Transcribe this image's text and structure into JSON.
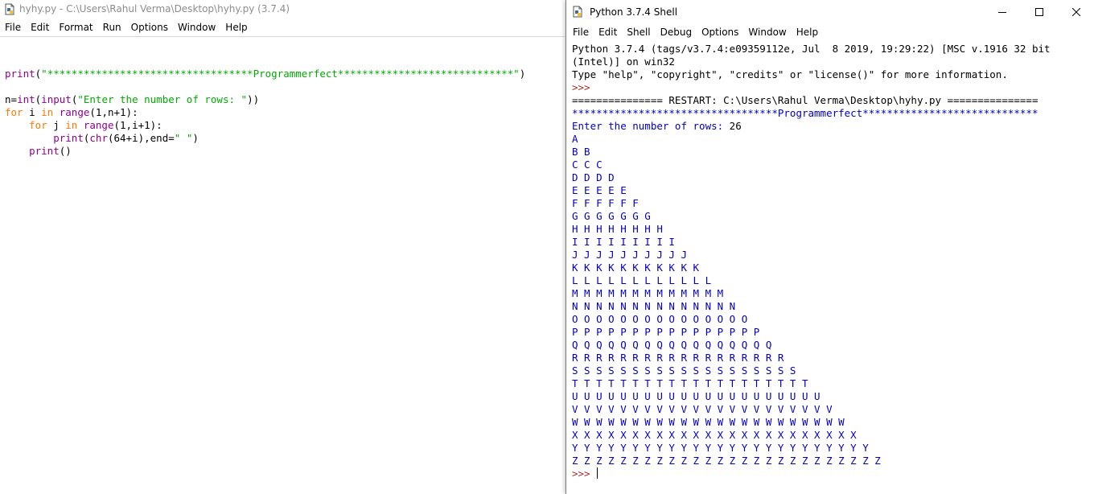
{
  "editor": {
    "title": "hyhy.py - C:\\Users\\Rahul Verma\\Desktop\\hyhy.py (3.7.4)",
    "menu": [
      "File",
      "Edit",
      "Format",
      "Run",
      "Options",
      "Window",
      "Help"
    ],
    "code": {
      "line1": {
        "fn": "print",
        "open": "(",
        "str": "\"**********************************Programmerfect*****************************\"",
        "close": ")"
      },
      "line2": "",
      "line3": {
        "a": "n=",
        "int": "int",
        "b": "(",
        "input": "input",
        "c": "(",
        "str": "\"Enter the number of rows: \"",
        "d": "))"
      },
      "line4": {
        "for": "for",
        "a": " i ",
        "in": "in",
        "sp": " ",
        "range": "range",
        "b": "(1,n+1):"
      },
      "line5": {
        "indent": "    ",
        "for": "for",
        "a": " j ",
        "in": "in",
        "sp": " ",
        "range": "range",
        "b": "(1,i+1):"
      },
      "line6": {
        "indent": "        ",
        "print": "print",
        "a": "(",
        "chr": "chr",
        "b": "(64+i),end=",
        "str": "\" \"",
        "c": ")"
      },
      "line7": {
        "indent": "    ",
        "print": "print",
        "a": "()"
      }
    }
  },
  "shell": {
    "title": "Python 3.7.4 Shell",
    "menu": [
      "File",
      "Edit",
      "Shell",
      "Debug",
      "Options",
      "Window",
      "Help"
    ],
    "banner1": "Python 3.7.4 (tags/v3.7.4:e09359112e, Jul  8 2019, 19:29:22) [MSC v.1916 32 bit",
    "banner2": "(Intel)] on win32",
    "banner3": "Type \"help\", \"copyright\", \"credits\" or \"license()\" for more information.",
    "prompt": ">>>",
    "restart": "=============== RESTART: C:\\Users\\Rahul Verma\\Desktop\\hyhy.py ===============",
    "stars": "**********************************Programmerfect*****************************",
    "input_prompt": "Enter the number of rows: ",
    "input_value": "26",
    "rows": [
      "A",
      "B B",
      "C C C",
      "D D D D",
      "E E E E E",
      "F F F F F F",
      "G G G G G G G",
      "H H H H H H H H",
      "I I I I I I I I I",
      "J J J J J J J J J J",
      "K K K K K K K K K K K",
      "L L L L L L L L L L L L",
      "M M M M M M M M M M M M M",
      "N N N N N N N N N N N N N N",
      "O O O O O O O O O O O O O O O",
      "P P P P P P P P P P P P P P P P",
      "Q Q Q Q Q Q Q Q Q Q Q Q Q Q Q Q Q",
      "R R R R R R R R R R R R R R R R R R",
      "S S S S S S S S S S S S S S S S S S S",
      "T T T T T T T T T T T T T T T T T T T T",
      "U U U U U U U U U U U U U U U U U U U U U",
      "V V V V V V V V V V V V V V V V V V V V V V",
      "W W W W W W W W W W W W W W W W W W W W W W W",
      "X X X X X X X X X X X X X X X X X X X X X X X X",
      "Y Y Y Y Y Y Y Y Y Y Y Y Y Y Y Y Y Y Y Y Y Y Y Y Y",
      "Z Z Z Z Z Z Z Z Z Z Z Z Z Z Z Z Z Z Z Z Z Z Z Z Z Z"
    ],
    "final_prompt": ">>> "
  },
  "icons": {
    "app": "idle-python-file-icon",
    "minimize": "minimize-icon",
    "maximize": "maximize-icon",
    "close": "close-icon"
  },
  "colors": {
    "keyword": "#ff7700",
    "builtin": "#900090",
    "string": "#00aa00",
    "output": "#0000c0",
    "prompt": "#a52a2a"
  }
}
